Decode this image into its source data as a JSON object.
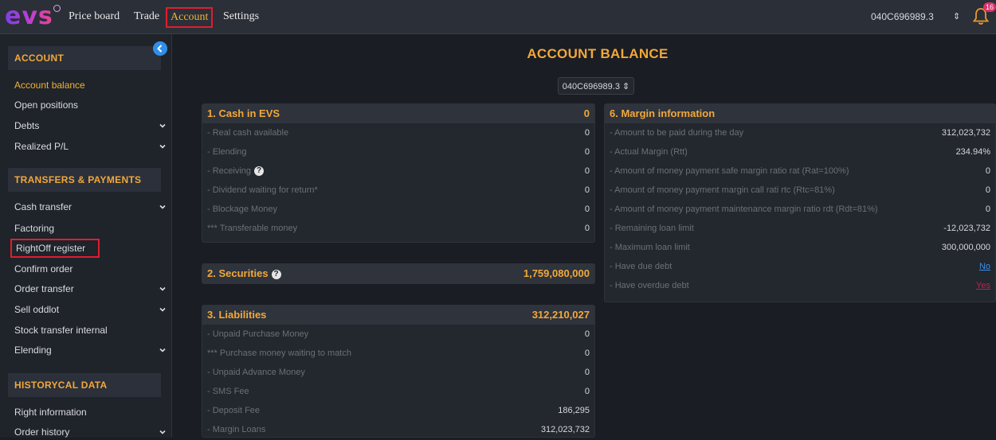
{
  "topbar": {
    "logo": "evs",
    "nav": [
      "Price board",
      "Trade",
      "Account",
      "Settings"
    ],
    "account_id": "040C696989.3",
    "notification_count": "16"
  },
  "sidebar": {
    "account_header": "ACCOUNT",
    "account_items": [
      "Account balance",
      "Open positions",
      "Debts",
      "Realized P/L"
    ],
    "transfers_header": "TRANSFERS & PAYMENTS",
    "transfer_items": [
      "Cash transfer",
      "Factoring",
      "RightOff register",
      "Confirm order",
      "Order transfer",
      "Sell oddlot",
      "Stock transfer internal",
      "Elending"
    ],
    "history_header": "HISTORYCAL DATA",
    "history_items": [
      "Right information",
      "Order history"
    ]
  },
  "main": {
    "title": "ACCOUNT BALANCE",
    "account_select": "040C696989.3"
  },
  "cash": {
    "title": "1. Cash in EVS",
    "total": "0",
    "rows": [
      {
        "label": "- Real cash available",
        "value": "0"
      },
      {
        "label": "- Elending",
        "value": "0"
      },
      {
        "label": "- Receiving",
        "value": "0"
      },
      {
        "label": "- Dividend waiting for return*",
        "value": "0"
      },
      {
        "label": "- Blockage Money",
        "value": "0"
      },
      {
        "label": "*** Transferable money",
        "value": "0"
      }
    ]
  },
  "securities": {
    "title": "2. Securities",
    "total": "1,759,080,000"
  },
  "liabilities": {
    "title": "3. Liabilities",
    "total": "312,210,027",
    "rows": [
      {
        "label": "- Unpaid Purchase Money",
        "value": "0"
      },
      {
        "label": "*** Purchase money waiting to match",
        "value": "0"
      },
      {
        "label": "- Unpaid Advance Money",
        "value": "0"
      },
      {
        "label": "- SMS Fee",
        "value": "0"
      },
      {
        "label": "- Deposit Fee",
        "value": "186,295"
      },
      {
        "label": "- Margin Loans",
        "value": "312,023,732"
      }
    ]
  },
  "margin": {
    "title": "6. Margin information",
    "rows": [
      {
        "label": "- Amount to be paid during the day",
        "value": "312,023,732"
      },
      {
        "label": "- Actual Margin (Rtt)",
        "value": "234.94%"
      },
      {
        "label": "- Amount of money payment safe margin ratio rat (Rat=100%)",
        "value": "0"
      },
      {
        "label": "- Amount of money payment margin call rati rtc (Rtc=81%)",
        "value": "0"
      },
      {
        "label": "- Amount of money payment maintenance margin ratio rdt (Rdt=81%)",
        "value": "0"
      },
      {
        "label": "- Remaining loan limit",
        "value": "-12,023,732"
      },
      {
        "label": "- Maximum loan limit",
        "value": "300,000,000"
      },
      {
        "label": "- Have due debt",
        "value": "No"
      },
      {
        "label": "- Have overdue debt",
        "value": "Yes"
      }
    ]
  },
  "colors": {
    "accent": "#f2a83a",
    "highlight_box": "#e11d2e",
    "link_blue": "#3b8de6",
    "link_red": "#c2224a"
  }
}
